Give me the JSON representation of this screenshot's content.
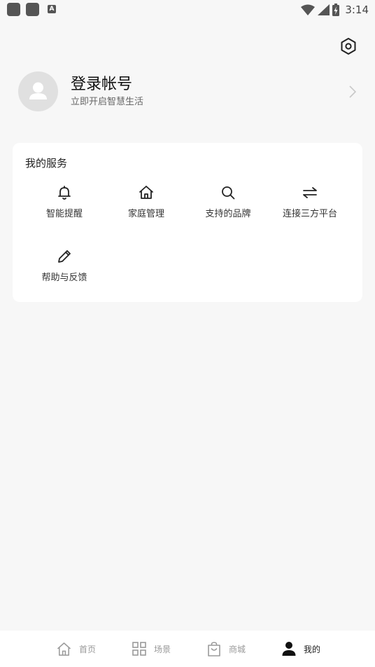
{
  "status_bar": {
    "time": "3:14",
    "left_icons": [
      "notification-icon",
      "notification-icon",
      "keyboard-icon"
    ],
    "right_icons": [
      "wifi-icon",
      "signal-icon",
      "battery-charging-icon"
    ],
    "small_badge": "A"
  },
  "header": {
    "settings_icon": "settings-icon"
  },
  "profile": {
    "title": "登录帐号",
    "subtitle": "立即开启智慧生活",
    "avatar_icon": "avatar-icon",
    "chevron_icon": "chevron-right-icon"
  },
  "services": {
    "title": "我的服务",
    "items": [
      {
        "label": "智能提醒",
        "icon": "bell-icon"
      },
      {
        "label": "家庭管理",
        "icon": "home-icon"
      },
      {
        "label": "支持的品牌",
        "icon": "search-icon"
      },
      {
        "label": "连接三方平台",
        "icon": "swap-icon"
      },
      {
        "label": "帮助与反馈",
        "icon": "pencil-icon"
      }
    ]
  },
  "bottom_nav": {
    "items": [
      {
        "label": "首页",
        "icon": "home-icon",
        "active": false
      },
      {
        "label": "场景",
        "icon": "grid-icon",
        "active": false
      },
      {
        "label": "商城",
        "icon": "shopping-bag-icon",
        "active": false
      },
      {
        "label": "我的",
        "icon": "person-icon",
        "active": true
      }
    ]
  },
  "colors": {
    "background": "#f7f7f7",
    "card": "#ffffff",
    "active_nav": "#222222",
    "inactive_nav": "#999999"
  }
}
